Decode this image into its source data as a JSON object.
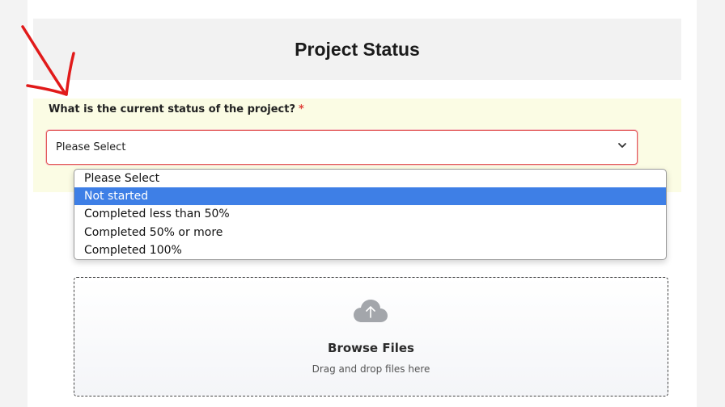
{
  "form": {
    "title": "Project Status",
    "question": {
      "label": "What is the current status of the project?",
      "required_mark": "*",
      "selected_value": "Please Select",
      "options": [
        {
          "label": "Please Select"
        },
        {
          "label": "Not started"
        },
        {
          "label": "Completed less than 50%"
        },
        {
          "label": "Completed 50% or more"
        },
        {
          "label": "Completed 100%"
        }
      ],
      "highlighted_option": "Not started"
    },
    "upload": {
      "button_label": "Browse Files",
      "hint": "Drag and drop files here",
      "icon": "cloud-upload-icon"
    }
  },
  "colors": {
    "required": "#e0413a",
    "highlight": "#3e7fe6",
    "annotation_arrow": "#e11a1a",
    "question_bg": "#fbfce4"
  }
}
